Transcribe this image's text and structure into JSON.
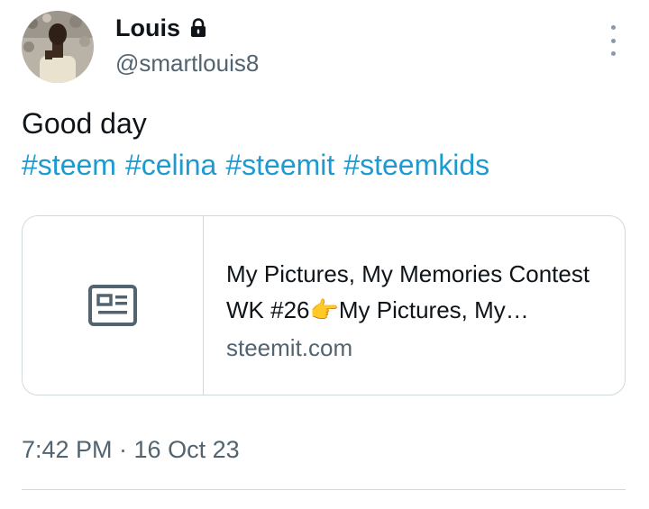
{
  "author": {
    "name": "Louis",
    "handle": "@smartlouis8",
    "lock_icon": "lock-icon",
    "avatar": "avatar-photo"
  },
  "tweet": {
    "text": "Good day",
    "hashtags": [
      "#steem",
      "#celina",
      "#steemit",
      "#steemkids"
    ]
  },
  "link_card": {
    "icon": "article-icon",
    "title": "My Pictures, My Memories Contest WK #26👉My Pictures, My Memories",
    "domain": "steemit.com"
  },
  "meta": {
    "timestamp": "7:42 PM · 16 Oct 23"
  },
  "colors": {
    "hashtag": "#1d9bd1",
    "secondary_text": "#536471",
    "border": "#cfd9de"
  }
}
